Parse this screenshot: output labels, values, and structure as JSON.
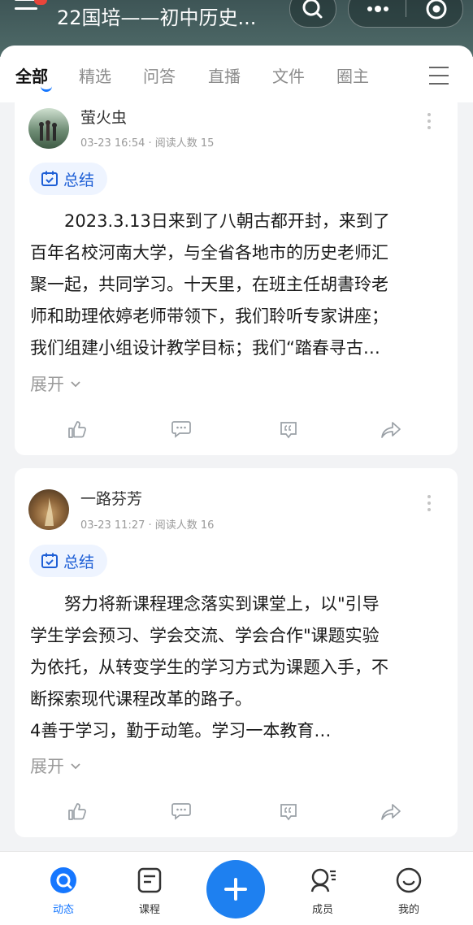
{
  "header": {
    "title": "22国培——初中历史..."
  },
  "tabs": [
    {
      "label": "全部",
      "active": true
    },
    {
      "label": "精选"
    },
    {
      "label": "问答"
    },
    {
      "label": "直播"
    },
    {
      "label": "文件"
    },
    {
      "label": "圈主"
    }
  ],
  "posts": [
    {
      "author": "萤火虫",
      "meta": "03-23 16:54 · 阅读人数 15",
      "tag": "总结",
      "lines": [
        "　　2023.3.13日来到了八朝古都开封，来到了",
        "百年名校河南大学，与全省各地市的历史老师汇",
        "聚一起，共同学习。十天里，在班主任胡書玲老",
        "师和助理依婷老师带领下，我们聆听专家讲座；",
        "我们组建小组设计教学目标；我们“踏春寻古…"
      ],
      "expand": "展开"
    },
    {
      "author": "一路芬芳",
      "meta": "03-23 11:27 · 阅读人数 16",
      "tag": "总结",
      "lines": [
        "　　努力将新课程理念落实到课堂上，以\"引导",
        "学生学会预习、学会交流、学会合作\"课题实验",
        "为依托，从转变学生的学习方式为课题入手，不",
        "断探索现代课程改革的路子。",
        "4善于学习，勤于动笔。学习一本教育…"
      ],
      "expand": "展开"
    }
  ],
  "bottom_nav": {
    "items": [
      {
        "label": "动态",
        "active": true
      },
      {
        "label": "课程"
      },
      {
        "label": "成员"
      },
      {
        "label": "我的"
      }
    ]
  },
  "colors": {
    "accent": "#1677ff",
    "tag_text": "#1e5fd6",
    "header_bg": "#4a6463"
  }
}
